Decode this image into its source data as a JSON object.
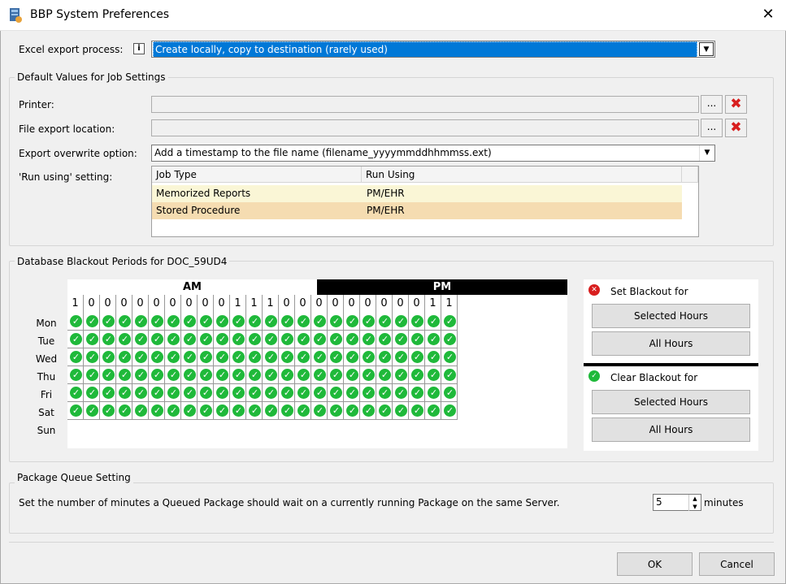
{
  "window": {
    "title": "BBP System Preferences"
  },
  "excel": {
    "label": "Excel export process:",
    "value": "Create locally, copy to destination (rarely used)"
  },
  "defaults": {
    "group_title": "Default Values for Job Settings",
    "printer_label": "Printer:",
    "printer_value": "",
    "file_label": "File export location:",
    "file_value": "",
    "overwrite_label": "Export overwrite option:",
    "overwrite_value": "Add a timestamp to the file name (filename_yyyymmddhhmmss.ext)",
    "run_label": "'Run using' setting:",
    "browse_label": "...",
    "clear_glyph": "✖",
    "table": {
      "headers": [
        "Job Type",
        "Run Using"
      ],
      "rows": [
        {
          "job": "Memorized Reports",
          "run": "PM/EHR",
          "color": "#faf6d6"
        },
        {
          "job": "Stored Procedure",
          "run": "PM/EHR",
          "color": "#f5dcb1"
        }
      ]
    }
  },
  "blackout": {
    "group_title": "Database Blackout Periods for DOC_59UD4",
    "am": "AM",
    "pm": "PM",
    "hours": [
      "1",
      "0",
      "0",
      "0",
      "0",
      "0",
      "0",
      "0",
      "0",
      "0",
      "1",
      "1",
      "1",
      "0",
      "0",
      "0",
      "0",
      "0",
      "0",
      "0",
      "0",
      "0",
      "1",
      "1"
    ],
    "days": [
      "Mon",
      "Tue",
      "Wed",
      "Thu",
      "Fri",
      "Sat",
      "Sun"
    ],
    "check_glyph": "✓",
    "set_title": "Set Blackout for",
    "set_selected": "Selected Hours",
    "set_all": "All Hours",
    "clear_title": "Clear Blackout for",
    "clear_selected": "Selected Hours",
    "clear_all": "All Hours",
    "colors": {
      "clear": "#1fb93a",
      "set": "#d81e1e"
    }
  },
  "queue": {
    "group_title": "Package Queue Setting",
    "text": "Set the number of minutes a Queued Package should wait on a currently running Package on the same Server.",
    "value": "5",
    "unit": "minutes"
  },
  "footer": {
    "ok": "OK",
    "cancel": "Cancel"
  }
}
